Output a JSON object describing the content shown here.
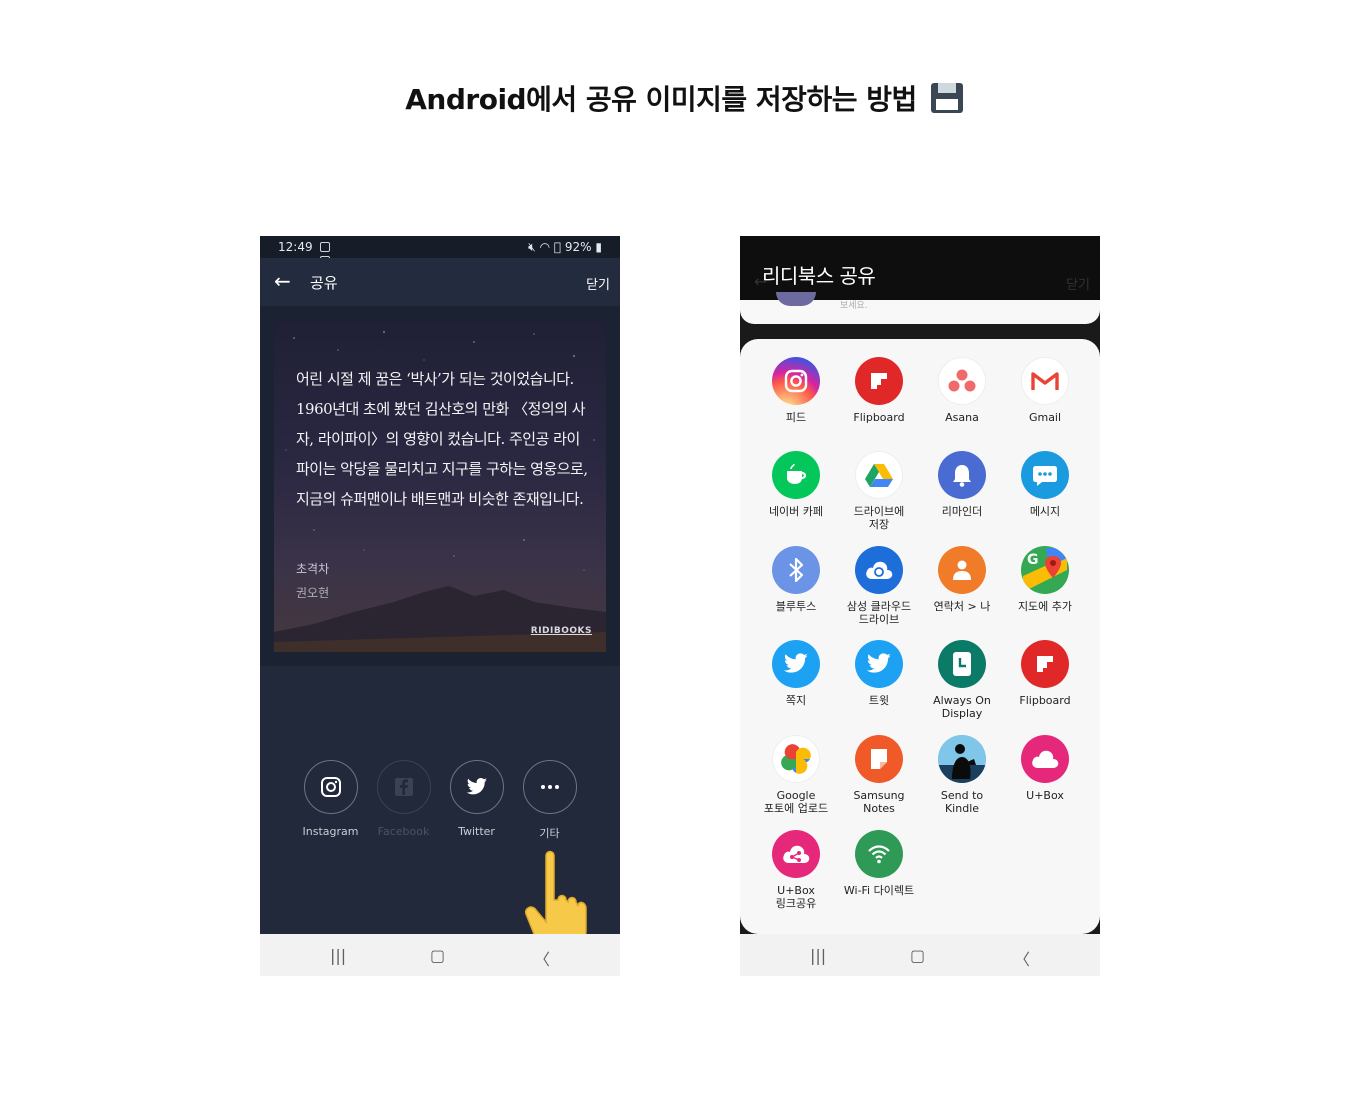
{
  "page": {
    "title": "Android에서 공유 이미지를 저장하는 방법"
  },
  "left_phone": {
    "status": {
      "time": "12:49",
      "battery": "92%"
    },
    "appbar": {
      "back_icon": "arrow-left-icon",
      "title": "공유",
      "close": "닫기"
    },
    "card": {
      "quote": "어린 시절 제 꿈은 ‘박사’가 되는 것이었습니다. 1960년대 초에 봤던 김산호의 만화 〈정의의 사자, 라이파이〉의 영향이 컸습니다. 주인공 라이파이는 악당을 물리치고 지구를 구하는 영웅으로, 지금의 슈퍼맨이나 배트맨과 비슷한 존재입니다.",
      "book": "초격차",
      "author": "권오현",
      "brand": "RIDIBOOKS"
    },
    "share": [
      {
        "label": "Instagram",
        "icon": "instagram-icon",
        "enabled": true
      },
      {
        "label": "Facebook",
        "icon": "facebook-icon",
        "enabled": false
      },
      {
        "label": "Twitter",
        "icon": "twitter-icon",
        "enabled": true
      },
      {
        "label": "기타",
        "icon": "more-icon",
        "enabled": true
      }
    ]
  },
  "right_phone": {
    "title": "리디북스 공유",
    "ghost": {
      "close": "닫기",
      "top_text": "보세요."
    },
    "apps": [
      {
        "label": "피드",
        "icon": "instagram-icon",
        "color": "#e1306c"
      },
      {
        "label": "Flipboard",
        "icon": "flipboard-icon",
        "color": "#e12828"
      },
      {
        "label": "Asana",
        "icon": "asana-icon",
        "color": "#f06a6a"
      },
      {
        "label": "Gmail",
        "icon": "gmail-icon",
        "color": "#ea4335"
      },
      {
        "label": "네이버 카페",
        "icon": "naver-cafe-icon",
        "color": "#03c75a"
      },
      {
        "label": "드라이브에\n저장",
        "icon": "google-drive-icon",
        "color": "#1fa463"
      },
      {
        "label": "리마인더",
        "icon": "reminder-bell-icon",
        "color": "#4a6bd1"
      },
      {
        "label": "메시지",
        "icon": "messages-icon",
        "color": "#1a9be0"
      },
      {
        "label": "블루투스",
        "icon": "bluetooth-icon",
        "color": "#6b93e6"
      },
      {
        "label": "삼성 클라우드\n드라이브",
        "icon": "samsung-cloud-icon",
        "color": "#1d6ed8"
      },
      {
        "label": "연락처 > 나",
        "icon": "contact-icon",
        "color": "#f07b29"
      },
      {
        "label": "지도에 추가",
        "icon": "google-maps-icon",
        "color": "#34a853"
      },
      {
        "label": "쪽지",
        "icon": "twitter-icon",
        "color": "#1da1f2"
      },
      {
        "label": "트윗",
        "icon": "twitter-icon",
        "color": "#1da1f2"
      },
      {
        "label": "Always On\nDisplay",
        "icon": "clock-icon",
        "color": "#0b7a67"
      },
      {
        "label": "Flipboard",
        "icon": "flipboard-icon",
        "color": "#e12828"
      },
      {
        "label": "Google\n포토에 업로드",
        "icon": "google-photos-icon",
        "color": "#fbbc05"
      },
      {
        "label": "Samsung\nNotes",
        "icon": "samsung-notes-icon",
        "color": "#f05a28"
      },
      {
        "label": "Send to\nKindle",
        "icon": "kindle-icon",
        "color": "#1b9ad6"
      },
      {
        "label": "U+Box",
        "icon": "uplus-box-icon",
        "color": "#e6287a"
      },
      {
        "label": "U+Box\n링크공유",
        "icon": "uplus-link-icon",
        "color": "#e6287a"
      },
      {
        "label": "Wi-Fi 다이렉트",
        "icon": "wifi-direct-icon",
        "color": "#2e9a55"
      }
    ]
  }
}
